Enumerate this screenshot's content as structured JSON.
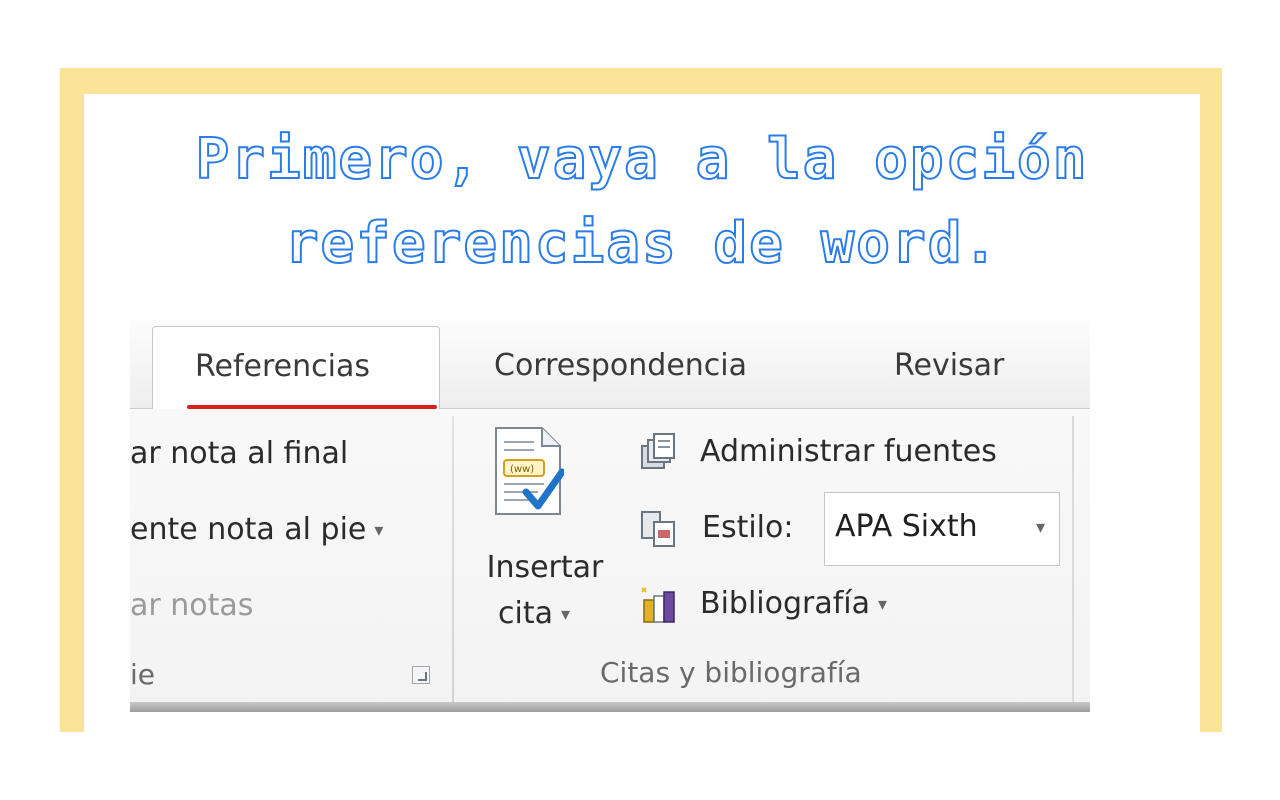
{
  "instruction": {
    "line1": "Primero, vaya a la opción",
    "line2": "referencias de word."
  },
  "colors": {
    "frame": "#fbe39a",
    "title_stroke": "#2a7de8",
    "active_tab_underline": "#d82020"
  },
  "ribbon": {
    "tabs": [
      {
        "label": "Referencias",
        "active": true
      },
      {
        "label": "Correspondencia",
        "active": false
      },
      {
        "label": "Revisar",
        "active": false
      }
    ],
    "footnotes_group": {
      "items": [
        {
          "label": "ar nota al final"
        },
        {
          "label": "ente nota al pie",
          "dropdown_caret": "▾"
        },
        {
          "label": "ar notas",
          "disabled": true
        }
      ],
      "group_label": "ie"
    },
    "citations_group": {
      "insert_citation": {
        "line1": "Insertar",
        "line2": "cita",
        "caret": "▾",
        "icon": "insert-citation-icon"
      },
      "manage_sources": {
        "label": "Administrar fuentes",
        "icon": "manage-sources-icon"
      },
      "style": {
        "label": "Estilo:",
        "value": "APA Sixth",
        "caret": "▾",
        "icon": "style-icon"
      },
      "bibliography": {
        "label": "Bibliografía",
        "caret": "▾",
        "icon": "bibliography-icon"
      },
      "group_label": "Citas y bibliografía"
    }
  }
}
